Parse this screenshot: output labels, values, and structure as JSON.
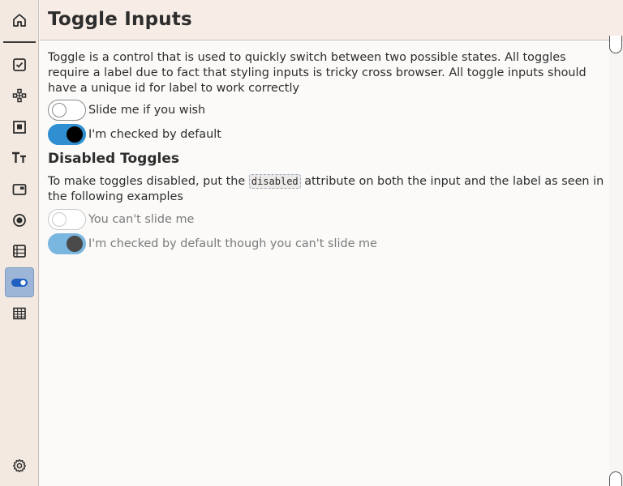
{
  "app": {
    "title": "Toggle Inputs"
  },
  "sidebar": {
    "items": [
      {
        "name": "home-icon"
      },
      {
        "name": "checkbox-icon"
      },
      {
        "name": "diagram-icon"
      },
      {
        "name": "square-frame-icon"
      },
      {
        "name": "typography-icon"
      },
      {
        "name": "window-icon"
      },
      {
        "name": "radio-icon"
      },
      {
        "name": "list-icon"
      },
      {
        "name": "toggle-icon",
        "active": true
      },
      {
        "name": "table-icon"
      },
      {
        "name": "gear-icon"
      }
    ]
  },
  "main": {
    "intro": "Toggle is a control that is used to quickly switch between two possible states. All toggles require a label due to fact that styling inputs is tricky cross browser. All toggle inputs should have a unique id for label to work correctly",
    "toggles": [
      {
        "label": "Slide me if you wish",
        "checked": false,
        "disabled": false
      },
      {
        "label": "I'm checked by default",
        "checked": true,
        "disabled": false
      }
    ],
    "disabled_heading": "Disabled Toggles",
    "disabled_desc_before": "To make toggles disabled, put the ",
    "disabled_code": "disabled",
    "disabled_desc_after": " attribute on both the input and the label as seen in the following examples",
    "disabled_toggles": [
      {
        "label": "You can't slide me",
        "checked": false,
        "disabled": true
      },
      {
        "label": "I'm checked by default though you can't slide me",
        "checked": true,
        "disabled": true
      }
    ]
  },
  "colors": {
    "accent": "#2f8fd0",
    "sidebar_active": "#9db6d7",
    "sidebar_bg": "#f3e9e1",
    "header_bg": "#f7ede6"
  }
}
